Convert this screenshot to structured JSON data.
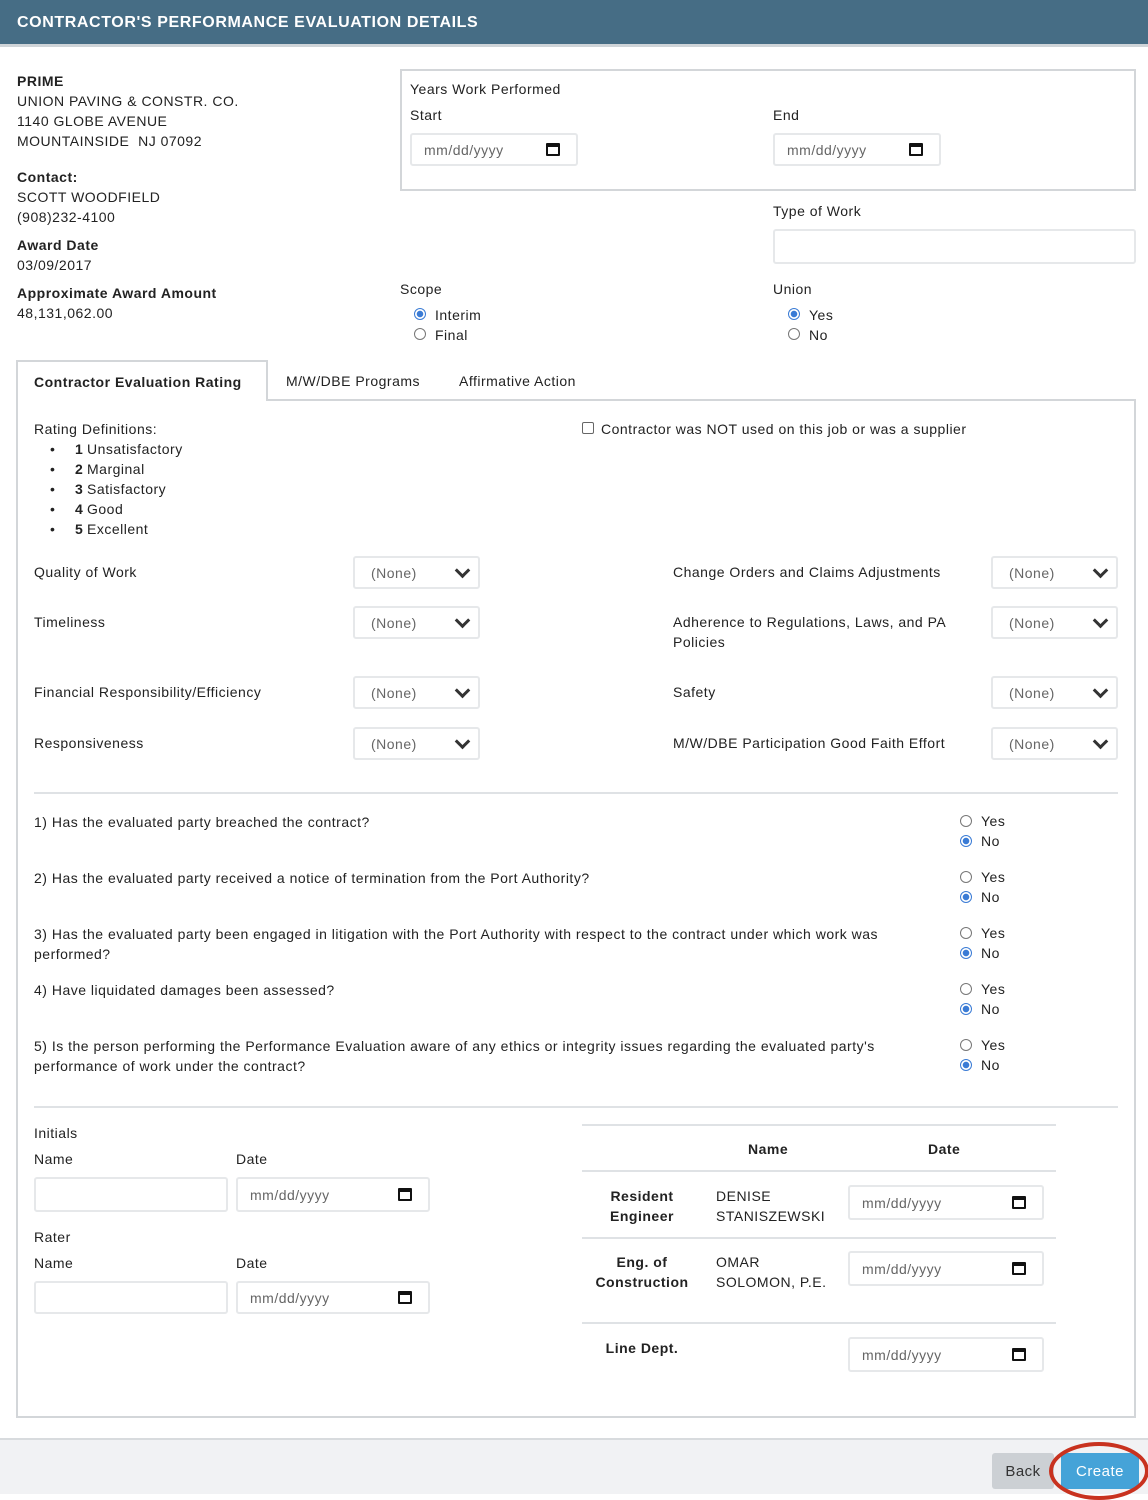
{
  "header": {
    "title": "CONTRACTOR'S PERFORMANCE EVALUATION DETAILS"
  },
  "contractor": {
    "type_label": "PRIME",
    "name": "UNION PAVING & CONSTR. CO.",
    "address1": "1140 GLOBE AVENUE",
    "address2": "MOUNTAINSIDE  NJ 07092",
    "contact_label": "Contact:",
    "contact_name": "SCOTT WOODFIELD",
    "contact_phone": "(908)232-4100",
    "award_date_label": "Award Date",
    "award_date": "03/09/2017",
    "award_amount_label": "Approximate Award Amount",
    "award_amount": "48,131,062.00"
  },
  "years": {
    "title": "Years Work Performed",
    "start_label": "Start",
    "start_placeholder": "mm/dd/yyyy",
    "end_label": "End",
    "end_placeholder": "mm/dd/yyyy"
  },
  "type_of_work": {
    "label": "Type of Work",
    "value": ""
  },
  "scope": {
    "label": "Scope",
    "options": [
      "Interim",
      "Final"
    ],
    "selected": "Interim"
  },
  "union": {
    "label": "Union",
    "options": [
      "Yes",
      "No"
    ],
    "selected": "Yes"
  },
  "tabs": [
    {
      "label": "Contractor Evaluation Rating",
      "active": true
    },
    {
      "label": "M/W/DBE Programs"
    },
    {
      "label": "Affirmative Action"
    }
  ],
  "ratings": {
    "definitions_label": "Rating Definitions:",
    "definitions": [
      {
        "n": "1",
        "t": "Unsatisfactory"
      },
      {
        "n": "2",
        "t": "Marginal"
      },
      {
        "n": "3",
        "t": "Satisfactory"
      },
      {
        "n": "4",
        "t": "Good"
      },
      {
        "n": "5",
        "t": "Excellent"
      }
    ],
    "not_used_label": "Contractor was NOT used on this job or was a supplier",
    "not_used_checked": false,
    "left": [
      {
        "label": "Quality of Work",
        "value": "(None)"
      },
      {
        "label": "Timeliness",
        "value": "(None)"
      },
      {
        "label": "Financial Responsibility/Efficiency",
        "value": "(None)"
      },
      {
        "label": "Responsiveness",
        "value": "(None)"
      }
    ],
    "right": [
      {
        "label": "Change Orders and Claims Adjustments",
        "value": "(None)"
      },
      {
        "label": "Adherence to Regulations, Laws, and PA Policies",
        "value": "(None)"
      },
      {
        "label": "Safety",
        "value": "(None)"
      },
      {
        "label": "M/W/DBE Participation Good Faith Effort",
        "value": "(None)"
      }
    ]
  },
  "questions": [
    {
      "text": "1) Has the evaluated party breached the contract?",
      "answer": "No"
    },
    {
      "text": "2) Has the evaluated party received a notice of termination from the Port Authority?",
      "answer": "No"
    },
    {
      "text": "3) Has the evaluated party been engaged in litigation with the Port Authority with respect to the contract under which work was performed?",
      "answer": "No"
    },
    {
      "text": "4) Have liquidated damages been assessed?",
      "answer": "No"
    },
    {
      "text": "5) Is the person performing the Performance Evaluation aware of any ethics or integrity issues regarding the evaluated party's performance of work under the contract?",
      "answer": "No"
    }
  ],
  "yes_label": "Yes",
  "no_label": "No",
  "initials": {
    "title": "Initials",
    "name_label": "Name",
    "date_label": "Date",
    "date_placeholder": "mm/dd/yyyy"
  },
  "rater": {
    "title": "Rater",
    "name_label": "Name",
    "date_label": "Date",
    "date_placeholder": "mm/dd/yyyy"
  },
  "signoff": {
    "name_header": "Name",
    "date_header": "Date",
    "rows": [
      {
        "role": "Resident Engineer",
        "name": "DENISE STANISZEWSKI",
        "date_placeholder": "mm/dd/yyyy"
      },
      {
        "role": "Eng. of Construction",
        "name": "OMAR SOLOMON, P.E.",
        "date_placeholder": "mm/dd/yyyy"
      },
      {
        "role": "Line Dept.",
        "name": "",
        "date_placeholder": "mm/dd/yyyy"
      }
    ]
  },
  "footer": {
    "back_label": "Back",
    "create_label": "Create"
  },
  "colors": {
    "header": "#466d85",
    "create": "#45a3d8",
    "back": "#ccd0d4",
    "annotation": "#c8321f"
  }
}
